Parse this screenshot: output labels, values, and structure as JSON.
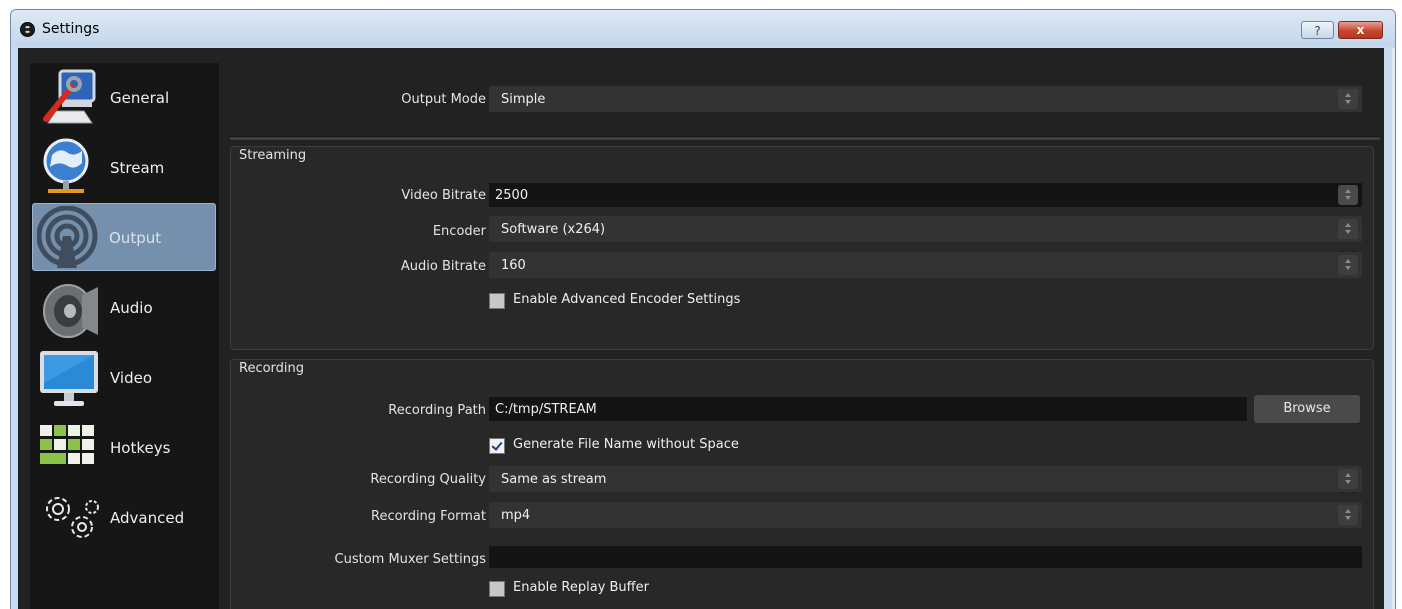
{
  "window": {
    "title": "Settings",
    "help_label": "?",
    "close_label": "x"
  },
  "sidebar": {
    "items": [
      {
        "label": "General",
        "icon": "general-icon",
        "active": false
      },
      {
        "label": "Stream",
        "icon": "stream-icon",
        "active": false
      },
      {
        "label": "Output",
        "icon": "output-icon",
        "active": true
      },
      {
        "label": "Audio",
        "icon": "audio-icon",
        "active": false
      },
      {
        "label": "Video",
        "icon": "video-icon",
        "active": false
      },
      {
        "label": "Hotkeys",
        "icon": "hotkeys-icon",
        "active": false
      },
      {
        "label": "Advanced",
        "icon": "advanced-icon",
        "active": false
      }
    ]
  },
  "output": {
    "output_mode_label": "Output Mode",
    "output_mode_value": "Simple",
    "streaming": {
      "title": "Streaming",
      "video_bitrate_label": "Video Bitrate",
      "video_bitrate_value": "2500",
      "encoder_label": "Encoder",
      "encoder_value": "Software (x264)",
      "audio_bitrate_label": "Audio Bitrate",
      "audio_bitrate_value": "160",
      "advanced_encoder_label": "Enable Advanced Encoder Settings",
      "advanced_encoder_checked": false
    },
    "recording": {
      "title": "Recording",
      "path_label": "Recording Path",
      "path_value": "C:/tmp/STREAM",
      "browse_label": "Browse",
      "no_space_label": "Generate File Name without Space",
      "no_space_checked": true,
      "quality_label": "Recording Quality",
      "quality_value": "Same as stream",
      "format_label": "Recording Format",
      "format_value": "mp4",
      "muxer_label": "Custom Muxer Settings",
      "muxer_value": "",
      "replay_label": "Enable Replay Buffer",
      "replay_checked": false
    }
  },
  "colors": {
    "background": "#222222",
    "sidebar": "#161616",
    "active": "#7590ad",
    "input": "#141414",
    "combo": "#333333"
  }
}
